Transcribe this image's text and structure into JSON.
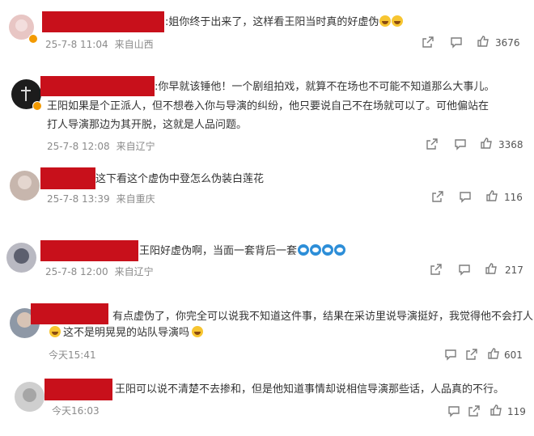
{
  "comments": [
    {
      "text": ":姐你终于出来了，这样看王阳当时真的好虚伪",
      "emojis": [
        "laugh-cry",
        "laugh-cry"
      ],
      "date": "25-7-8 11:04",
      "location": "来自山西",
      "likes": "3676",
      "avatar_color": "#e8c6c4"
    },
    {
      "text": ":你早就该锤他！一个剧组拍戏，就算不在场也不可能不知道那么大事儿。",
      "line2": "王阳如果是个正派人，但不想卷入你与导演的纠纷，他只要说自己不在场就可以了。可他偏站在",
      "line3": "打人导演那边为其开脱，这就是人品问题。",
      "date": "25-7-8 12:08",
      "location": "来自辽宁",
      "likes": "3368",
      "avatar_color": "#1c1c1c"
    },
    {
      "text": "这下看这个虚伪中登怎么伪装白莲花",
      "date": "25-7-8 13:39",
      "location": "来自重庆",
      "likes": "116",
      "avatar_color": "#c7b6ad"
    },
    {
      "text": "王阳好虚伪啊，当面一套背后一套",
      "emojis": [
        "doge",
        "doge",
        "doge",
        "doge"
      ],
      "date": "25-7-8 12:00",
      "location": "来自辽宁",
      "likes": "217",
      "avatar_color": "#b9b9c2"
    },
    {
      "text": "有点虚伪了，你完全可以说我不知道这件事，结果在采访里说导演挺好，我觉得他不会打人",
      "line2": "这不是明晃晃的站队导演吗",
      "date": "今天15:41",
      "likes": "601",
      "avatar_color": "#8e98a6"
    },
    {
      "text": "王阳可以说不清楚不去掺和，但是他知道事情却说相信导演那些话，人品真的不行。",
      "date": "今天16:03",
      "likes": "119",
      "avatar_color": "#cfcfcf"
    }
  ],
  "icons": {
    "share": "share-icon",
    "comment": "comment-icon",
    "like": "like-icon"
  },
  "colors": {
    "redaction": "#c8101b",
    "meta_text": "#8b8b8b"
  }
}
